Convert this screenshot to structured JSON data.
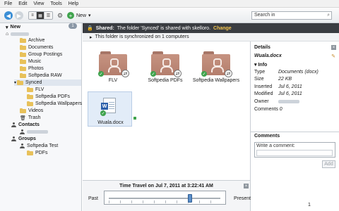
{
  "menu": [
    "File",
    "Edit",
    "View",
    "Tools",
    "Help"
  ],
  "toolbar": {
    "new_label": "New",
    "search_placeholder": "Search in"
  },
  "sidebar": {
    "new_label": "New",
    "new_count": "1",
    "folders": [
      "Archive",
      "Documents",
      "Group Postings",
      "Music",
      "Photos",
      "Softpedia RAW",
      "Synced",
      "FLV",
      "Softpedia PDFs",
      "Softpedia Wallpapers",
      "Videos",
      "Trash"
    ],
    "contacts_label": "Contacts",
    "groups_label": "Groups",
    "group_name": "Softpedia Test",
    "group_sub": "PDFs"
  },
  "shared_bar": {
    "prefix": "Shared:",
    "text": "The folder 'Synced' is shared with skelloro.",
    "link": "Change"
  },
  "sync_bar": {
    "text": "This folder is synchronized on 1 computers"
  },
  "items": [
    {
      "name": "FLV"
    },
    {
      "name": "Softpedia PDFs"
    },
    {
      "name": "Softpedia Wallpapers"
    },
    {
      "name": "Wuala.docx"
    }
  ],
  "details": {
    "title": "Details",
    "filename": "Wuala.docx",
    "info_label": "Info",
    "rows": [
      {
        "k": "Type",
        "v": "Documents (docx)"
      },
      {
        "k": "Size",
        "v": "22 KB"
      },
      {
        "k": "Inserted",
        "v": "Jul 6, 2011"
      },
      {
        "k": "Modified",
        "v": "Jul 6, 2011"
      },
      {
        "k": "Owner",
        "v": ""
      },
      {
        "k": "Comments",
        "v": "0"
      }
    ],
    "comments_title": "Comments",
    "comment_placeholder": "Write a comment:",
    "add_label": "Add"
  },
  "time_travel": {
    "title": "Time Travel on Jul 7, 2011 at 3:22:41 AM",
    "past": "Past",
    "present": "Present",
    "position": 0.73
  },
  "pager": "1"
}
